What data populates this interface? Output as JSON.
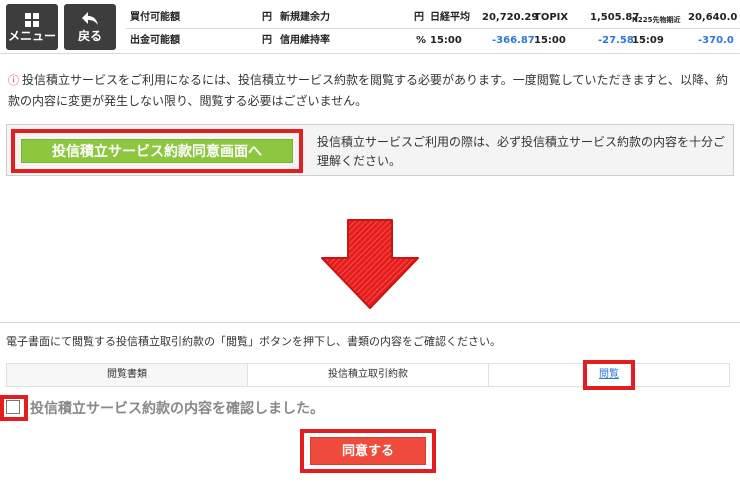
{
  "header": {
    "menu_label": "メニュー",
    "back_label": "戻る",
    "buy_power_label": "買付可能額",
    "buy_power_unit": "円",
    "withdraw_label": "出金可能額",
    "withdraw_unit": "円",
    "new_margin_label": "新規建余力",
    "new_margin_unit": "円",
    "margin_ratio_label": "信用維持率",
    "margin_ratio_unit": "%",
    "market": [
      {
        "name": "日経平均",
        "value": "20,720.29",
        "time": "15:00",
        "change": "-366.87"
      },
      {
        "name": "TOPIX",
        "value": "1,505.87",
        "time": "15:00",
        "change": "-27.58"
      },
      {
        "name": "N225先物期近",
        "value": "20,640.0",
        "time": "15:09",
        "change": "-370.0"
      }
    ]
  },
  "notice": {
    "icon": "warning-circle-icon",
    "text": "投信積立サービスをご利用になるには、投信積立サービス約款を閲覧する必要があります。一度閲覧していただきますと、以降、約款の内容に変更が発生しない限り、閲覧する必要はございません。"
  },
  "agree_box": {
    "button_label": "投信積立サービス約款同意画面へ",
    "description": "投信積立サービスご利用の際は、必ず投信積立サービス約款の内容を十分ご理解ください。"
  },
  "bottom": {
    "instruction": "電子書面にて閲覧する投信積立取引約款の「閲覧」ボタンを押下し、書類の内容をご確認ください。",
    "table": {
      "col_type": "閲覧書類",
      "doc_name": "投信積立取引約款",
      "view_link": "閲覧"
    },
    "checkbox_label": "投信積立サービス約款の内容を確認しました。",
    "submit_label": "同意する"
  },
  "colors": {
    "accent_red": "#e41e1e",
    "green_button": "#8dc63f",
    "submit_red": "#ef4b3c",
    "negative_blue": "#2b78d6"
  }
}
